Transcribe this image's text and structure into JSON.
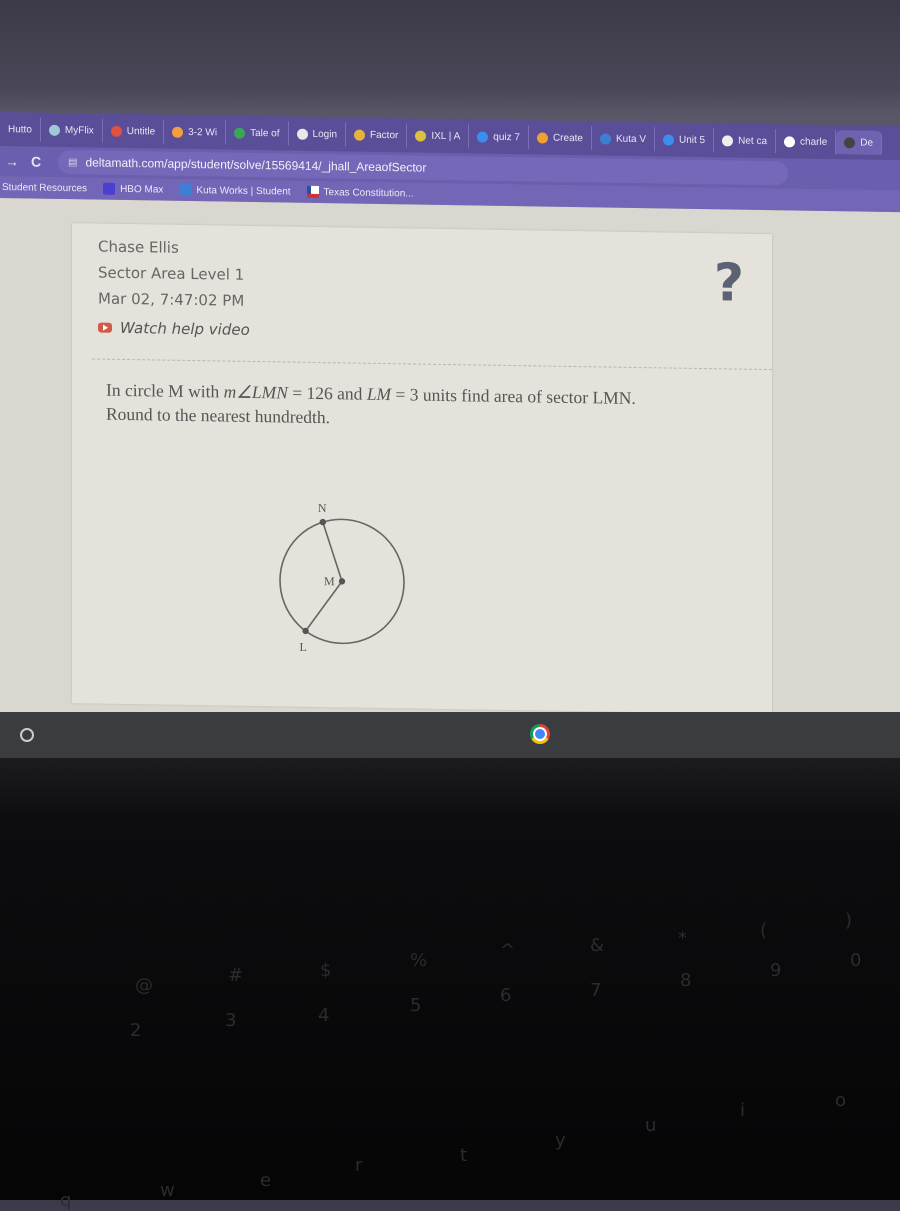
{
  "browser": {
    "tabs": [
      {
        "label": "Hutto",
        "icon": "school-icon",
        "color": "#cccccc"
      },
      {
        "label": "MyFlix",
        "icon": "myflix-icon",
        "color": "#9fc9d8"
      },
      {
        "label": "Untitle",
        "icon": "map-pin-icon",
        "color": "#e0513f"
      },
      {
        "label": "3-2 Wi",
        "icon": "hw-icon",
        "color": "#f0a040"
      },
      {
        "label": "Tale of",
        "icon": "drive-icon",
        "color": "#3aa757"
      },
      {
        "label": "Login",
        "icon": "globe-icon",
        "color": "#e8e8e8"
      },
      {
        "label": "Factor",
        "icon": "factor-icon",
        "color": "#e7b43a"
      },
      {
        "label": "IXL | A",
        "icon": "ixl-icon",
        "color": "#d9c23e"
      },
      {
        "label": "quiz 7",
        "icon": "search-icon",
        "color": "#3b8ef0"
      },
      {
        "label": "Create",
        "icon": "create-icon",
        "color": "#f0a030"
      },
      {
        "label": "Kuta V",
        "icon": "kuta-icon",
        "color": "#3e7fd6"
      },
      {
        "label": "Unit 5",
        "icon": "search-icon",
        "color": "#3b8ef0"
      },
      {
        "label": "Net ca",
        "icon": "wikipedia-icon",
        "color": "#eeeeee"
      },
      {
        "label": "charle",
        "icon": "google-icon",
        "color": "#ffffff"
      },
      {
        "label": "De",
        "icon": "deltamath-icon",
        "color": "#444444"
      }
    ],
    "nav": {
      "forward": "→",
      "reload": "C"
    },
    "address": "deltamath.com/app/student/solve/15569414/_jhall_AreaofSector",
    "bookmarks": [
      {
        "label": "Student Resources",
        "icon": ""
      },
      {
        "label": "HBO Max",
        "icon": "hbo-icon"
      },
      {
        "label": "Kuta Works | Student",
        "icon": "kuta-icon"
      },
      {
        "label": "Texas Constitution...",
        "icon": "flag-icon"
      }
    ]
  },
  "problem": {
    "student_name": "Chase Ellis",
    "assignment": "Sector Area Level 1",
    "timestamp": "Mar 02, 7:47:02 PM",
    "help_video": "Watch help video",
    "help_symbol": "?",
    "question_parts": {
      "p1": "In circle M with ",
      "expr1": "m∠LMN",
      "p2": " = 126 and ",
      "expr2": "LM",
      "p3": " = 3 units find area of sector LMN.",
      "line2": "Round to the nearest hundredth."
    },
    "diagram": {
      "center_label": "M",
      "point_n_label": "N",
      "point_l_label": "L",
      "angle_degrees": 126,
      "radius_units": 3
    }
  },
  "keyboard_keys": [
    "2",
    "3",
    "4",
    "5",
    "6",
    "7",
    "8",
    "9",
    "0",
    "@",
    "#",
    "$",
    "%",
    "^",
    "&",
    "*",
    "(",
    ")",
    "q",
    "w",
    "e",
    "r",
    "t",
    "y",
    "u",
    "i",
    "o"
  ]
}
